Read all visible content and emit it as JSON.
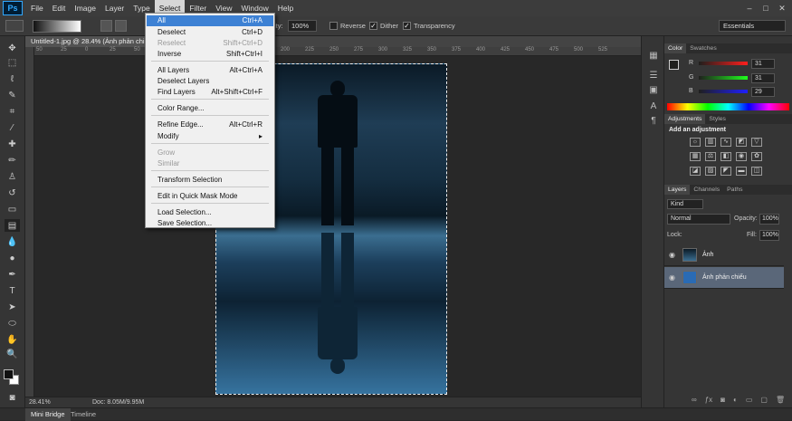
{
  "app": {
    "logo": "Ps"
  },
  "menubar": {
    "items": [
      "File",
      "Edit",
      "Image",
      "Layer",
      "Type",
      "Select",
      "Filter",
      "View",
      "Window",
      "Help"
    ],
    "active": "Select"
  },
  "window_controls": {
    "minimize": "–",
    "restore": "□",
    "close": "✕"
  },
  "options": {
    "opacity_label": "ity:",
    "opacity_value": "100%",
    "reverse": "Reverse",
    "dither": "Dither",
    "transparency": "Transparency",
    "workspace": "Essentials"
  },
  "document": {
    "tab_title": "Untitled-1.jpg @ 28.4% (Ảnh phản chi"
  },
  "ruler": [
    "50",
    "25",
    "0",
    "25",
    "50",
    "75",
    "100",
    "125",
    "150",
    "175",
    "200",
    "225",
    "250",
    "275",
    "300",
    "325",
    "350",
    "375",
    "400",
    "425",
    "450",
    "475",
    "500",
    "525"
  ],
  "select_menu": {
    "items": [
      {
        "label": "All",
        "shortcut": "Ctrl+A",
        "highlight": true
      },
      {
        "label": "Deselect",
        "shortcut": "Ctrl+D"
      },
      {
        "label": "Reselect",
        "shortcut": "Shift+Ctrl+D",
        "disabled": true
      },
      {
        "label": "Inverse",
        "shortcut": "Shift+Ctrl+I"
      },
      {
        "label": "All Layers",
        "shortcut": "Alt+Ctrl+A"
      },
      {
        "label": "Deselect Layers",
        "shortcut": ""
      },
      {
        "label": "Find Layers",
        "shortcut": "Alt+Shift+Ctrl+F"
      },
      {
        "label": "Color Range...",
        "shortcut": ""
      },
      {
        "label": "Refine Edge...",
        "shortcut": "Alt+Ctrl+R"
      },
      {
        "label": "Modify",
        "shortcut": "▸"
      },
      {
        "label": "Grow",
        "shortcut": "",
        "disabled": true
      },
      {
        "label": "Similar",
        "shortcut": "",
        "disabled": true
      },
      {
        "label": "Transform Selection",
        "shortcut": ""
      },
      {
        "label": "Edit in Quick Mask Mode",
        "shortcut": ""
      },
      {
        "label": "Load Selection...",
        "shortcut": ""
      },
      {
        "label": "Save Selection...",
        "shortcut": ""
      }
    ]
  },
  "status": {
    "zoom": "28.41%",
    "doc": "Doc: 8.05M/9.95M"
  },
  "bottom_tabs": [
    "Mini Bridge",
    "Timeline"
  ],
  "color_panel": {
    "tabs": [
      "Color",
      "Swatches"
    ],
    "channels": [
      {
        "name": "R",
        "value": "31"
      },
      {
        "name": "G",
        "value": "31"
      },
      {
        "name": "B",
        "value": "29"
      }
    ]
  },
  "adjustments_panel": {
    "tabs": [
      "Adjustments",
      "Styles"
    ],
    "title": "Add an adjustment"
  },
  "layers_panel": {
    "tabs": [
      "Layers",
      "Channels",
      "Paths"
    ],
    "kind": "Kind",
    "blend": "Normal",
    "opacity_label": "Opacity:",
    "opacity": "100%",
    "lock_label": "Lock:",
    "fill_label": "Fill:",
    "fill": "100%",
    "layers": [
      {
        "name": "Ảnh",
        "selected": false
      },
      {
        "name": "Ảnh phản chiếu",
        "selected": true
      }
    ]
  },
  "colors": {
    "highlight": "#3d81d4",
    "accent": "#31a8ff"
  }
}
